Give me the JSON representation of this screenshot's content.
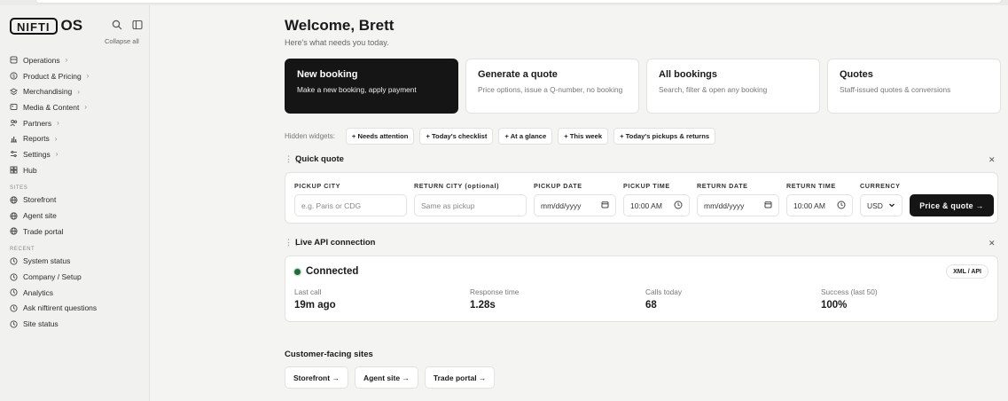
{
  "brand": {
    "logo_box": "NIFTI",
    "logo_os": "OS",
    "collapse_all": "Collapse all"
  },
  "sidebar": {
    "main_items": [
      {
        "label": "Operations",
        "icon": "operations-icon"
      },
      {
        "label": "Product & Pricing",
        "icon": "tag-icon"
      },
      {
        "label": "Merchandising",
        "icon": "layers-icon"
      },
      {
        "label": "Media & Content",
        "icon": "image-icon"
      },
      {
        "label": "Partners",
        "icon": "partners-icon"
      },
      {
        "label": "Reports",
        "icon": "chart-icon"
      },
      {
        "label": "Settings",
        "icon": "settings-icon"
      },
      {
        "label": "Hub",
        "icon": "grid-icon"
      }
    ],
    "sites_label": "SITES",
    "sites": [
      {
        "label": "Storefront"
      },
      {
        "label": "Agent site"
      },
      {
        "label": "Trade portal"
      }
    ],
    "recent_label": "RECENT",
    "recent": [
      {
        "label": "System status"
      },
      {
        "label": "Company / Setup"
      },
      {
        "label": "Analytics"
      },
      {
        "label": "Ask niftirent questions"
      },
      {
        "label": "Site status"
      }
    ]
  },
  "header": {
    "welcome": "Welcome, Brett",
    "subtitle": "Here's what needs you today."
  },
  "cards": [
    {
      "title": "New booking",
      "sub": "Make a new booking, apply payment"
    },
    {
      "title": "Generate a quote",
      "sub": "Price options, issue a Q-number, no booking"
    },
    {
      "title": "All bookings",
      "sub": "Search, filter & open any booking"
    },
    {
      "title": "Quotes",
      "sub": "Staff-issued quotes & conversions"
    }
  ],
  "hidden_widgets": {
    "label": "Hidden widgets:",
    "chips": [
      "+ Needs attention",
      "+ Today's checklist",
      "+ At a glance",
      "+ This week",
      "+ Today's pickups & returns"
    ]
  },
  "quick_quote": {
    "title": "Quick quote",
    "pickup_city": {
      "label": "PICKUP CITY",
      "placeholder": "e.g. Paris or CDG"
    },
    "return_city": {
      "label": "RETURN CITY (optional)",
      "placeholder": "Same as pickup"
    },
    "pickup_date": {
      "label": "PICKUP DATE",
      "value": "mm/dd/yyyy"
    },
    "pickup_time": {
      "label": "PICKUP TIME",
      "value": "10:00 AM"
    },
    "return_date": {
      "label": "RETURN DATE",
      "value": "mm/dd/yyyy"
    },
    "return_time": {
      "label": "RETURN TIME",
      "value": "10:00 AM"
    },
    "currency": {
      "label": "CURRENCY",
      "value": "USD"
    },
    "button": "Price & quote →"
  },
  "api": {
    "title": "Live API connection",
    "status": "Connected",
    "badge": "XML / API",
    "status_color": "#1f6b3a",
    "stats": [
      {
        "label": "Last call",
        "value": "19m ago"
      },
      {
        "label": "Response time",
        "value": "1.28s"
      },
      {
        "label": "Calls today",
        "value": "68"
      },
      {
        "label": "Success (last 50)",
        "value": "100%"
      }
    ]
  },
  "customer_sites": {
    "title": "Customer-facing sites",
    "links": [
      "Storefront →",
      "Agent site →",
      "Trade portal →"
    ]
  }
}
